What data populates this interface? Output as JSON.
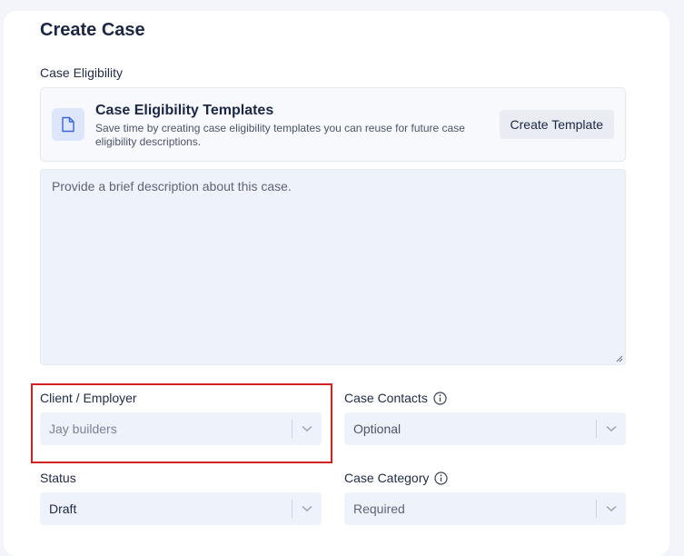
{
  "page": {
    "title": "Create Case"
  },
  "eligibility": {
    "section_label": "Case Eligibility",
    "template_title": "Case Eligibility Templates",
    "template_desc": "Save time by creating case eligibility templates you can reuse for future case eligibility descriptions.",
    "create_template_label": "Create Template",
    "description_placeholder": "Provide a brief description about this case."
  },
  "fields": {
    "client_employer": {
      "label": "Client / Employer",
      "value": "Jay builders"
    },
    "case_contacts": {
      "label": "Case Contacts",
      "value": "Optional"
    },
    "status": {
      "label": "Status",
      "value": "Draft"
    },
    "case_category": {
      "label": "Case Category",
      "value": "Required"
    }
  },
  "colors": {
    "accent_highlight": "#d32020",
    "field_bg": "#eef2fb",
    "icon_bg": "#dde6fb"
  },
  "icons": {
    "template": "document-icon",
    "info": "info-icon",
    "dropdown": "chevron-down-icon"
  }
}
